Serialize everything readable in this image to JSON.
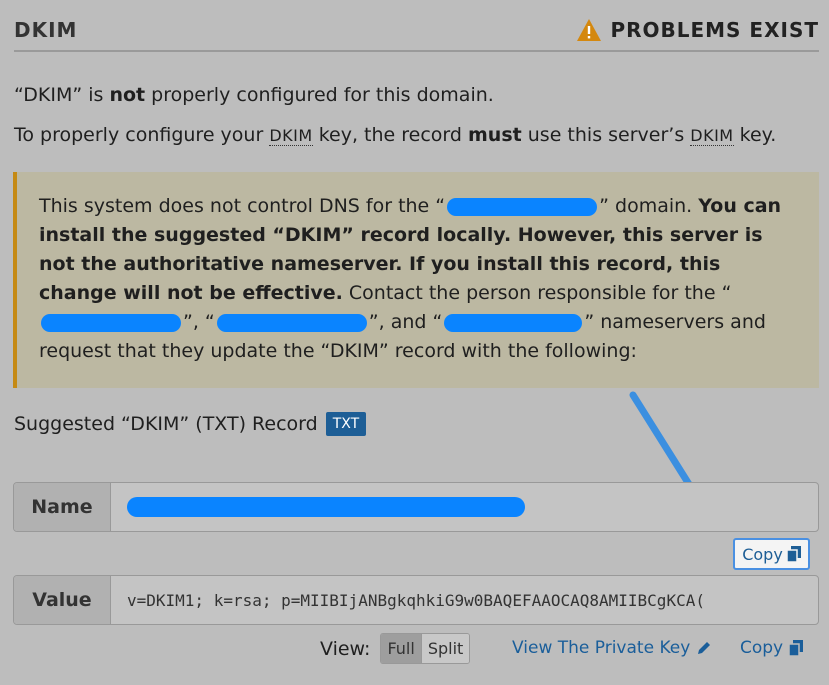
{
  "header": {
    "title": "DKIM",
    "status": "PROBLEMS EXIST"
  },
  "intro": {
    "line1_a": "“DKIM” is ",
    "line1_bold": "not",
    "line1_b": " properly configured for this domain.",
    "line2_a": "To properly configure your ",
    "line2_abbr": "DKIM",
    "line2_b": " key, the record ",
    "line2_bold": "must",
    "line2_c": " use this server’s ",
    "line2_abbr2": "DKIM",
    "line2_d": " key."
  },
  "alert": {
    "p1": "This system does not control DNS for the “",
    "p2": "” domain. ",
    "bold": "You can install the suggested “DKIM” record locally. However, this server is not the authoritative nameserver. If you install this record, this change will not be effective.",
    "p3": " Contact the person responsible for the “",
    "p4": "”, “",
    "p5": "”, and “",
    "p6": "” nameservers and request that they update the “DKIM” record with the following:"
  },
  "suggested": {
    "label": "Suggested “DKIM” (TXT) Record",
    "badge": "TXT"
  },
  "name_field": {
    "label": "Name"
  },
  "copy_button": {
    "label": "Copy"
  },
  "value_field": {
    "label": "Value",
    "value": "v=DKIM1; k=rsa; p=MIIBIjANBgkqhkiG9w0BAQEFAAOCAQ8AMIIBCgKCA("
  },
  "view": {
    "label": "View:",
    "full": "Full",
    "split": "Split"
  },
  "links": {
    "private_key": "View The Private Key",
    "copy": "Copy"
  },
  "colors": {
    "redaction": "#0a84ff",
    "warning": "#d4880f",
    "link": "#1a5e9a",
    "accent_border": "#c58a14"
  }
}
